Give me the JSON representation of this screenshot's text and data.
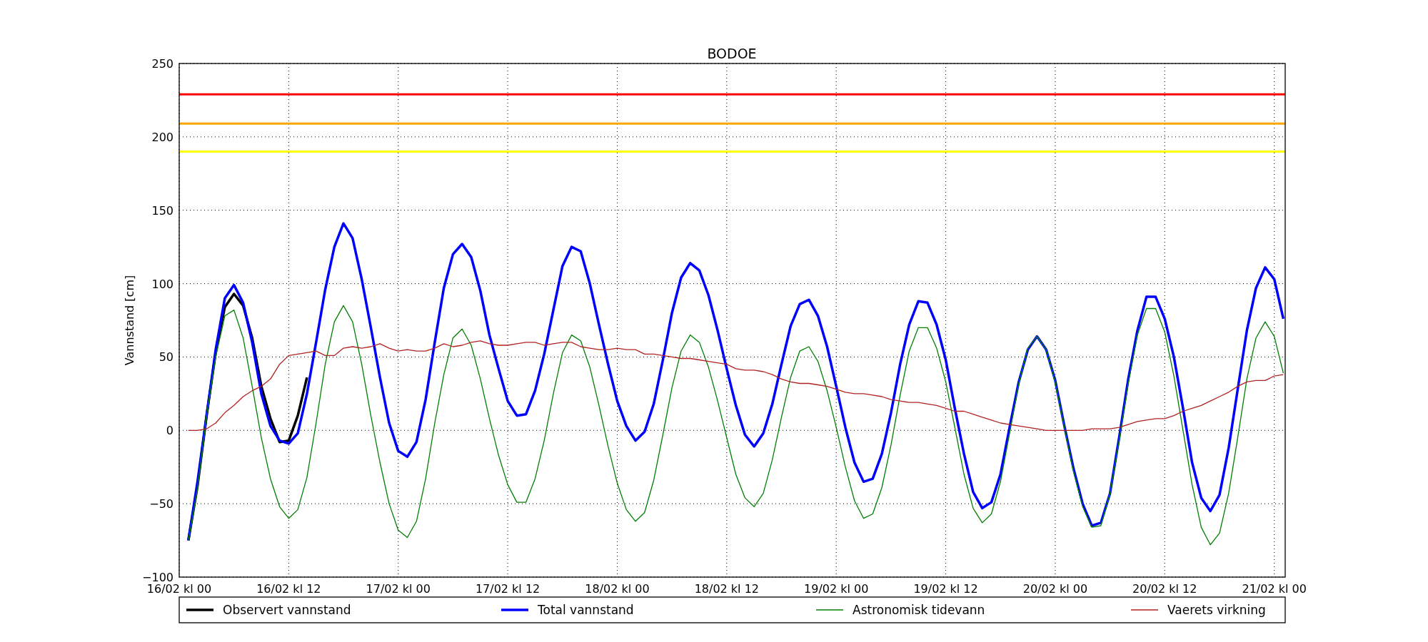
{
  "chart_data": {
    "type": "line",
    "title": "BODOE",
    "ylabel": "Vannstand [cm]",
    "categories": [
      "16/02 kl 00",
      null,
      null,
      null,
      null,
      null,
      null,
      null,
      null,
      null,
      null,
      null,
      "16/02 kl 12",
      null,
      null,
      null,
      null,
      null,
      null,
      null,
      null,
      null,
      null,
      null,
      "17/02 kl 00",
      null,
      null,
      null,
      null,
      null,
      null,
      null,
      null,
      null,
      null,
      null,
      "17/02 kl 12",
      null,
      null,
      null,
      null,
      null,
      null,
      null,
      null,
      null,
      null,
      null,
      "18/02 kl 00",
      null,
      null,
      null,
      null,
      null,
      null,
      null,
      null,
      null,
      null,
      null,
      "18/02 kl 12",
      null,
      null,
      null,
      null,
      null,
      null,
      null,
      null,
      null,
      null,
      null,
      "19/02 kl 00",
      null,
      null,
      null,
      null,
      null,
      null,
      null,
      null,
      null,
      null,
      null,
      "19/02 kl 12",
      null,
      null,
      null,
      null,
      null,
      null,
      null,
      null,
      null,
      null,
      null,
      "20/02 kl 00",
      null,
      null,
      null,
      null,
      null,
      null,
      null,
      null,
      null,
      null,
      null,
      "20/02 kl 12",
      null,
      null,
      null,
      null,
      null,
      null,
      null,
      null,
      null,
      null,
      null,
      "21/02 kl 00",
      null
    ],
    "ylim": [
      -100,
      250
    ],
    "yticks": [
      {
        "value": -100,
        "label": "−100"
      },
      {
        "value": -50,
        "label": "−50"
      },
      0,
      50,
      100,
      150,
      200,
      250
    ],
    "series": [
      {
        "name": "Observert vannstand",
        "color": "#000000",
        "values": [
          null,
          -75,
          -38,
          10,
          53,
          84,
          93,
          85,
          63,
          30,
          8,
          -8,
          -7,
          10,
          36,
          null,
          null,
          null,
          null,
          null,
          null,
          null,
          null,
          null,
          null,
          null,
          null,
          null,
          null,
          null,
          null,
          null,
          null,
          null,
          null,
          null,
          null,
          null,
          null,
          null,
          null,
          null,
          null,
          null,
          null,
          null,
          null,
          null,
          null,
          null,
          null,
          null,
          null,
          null,
          null,
          null,
          null,
          null,
          null,
          null,
          null,
          null,
          null,
          null,
          null,
          null,
          null,
          null,
          null,
          null,
          null,
          null,
          null,
          null,
          null,
          null,
          null,
          null,
          null,
          null,
          null,
          null,
          null,
          null,
          null,
          null,
          null,
          null,
          null,
          null,
          null,
          null,
          null,
          null,
          null,
          null,
          null,
          null,
          null,
          null,
          null,
          null,
          null,
          null,
          null,
          null,
          null,
          null,
          null,
          null,
          null,
          null,
          null,
          null,
          null,
          null,
          null,
          null,
          null,
          null,
          null,
          null
        ]
      },
      {
        "name": "Total vannstand",
        "color": "#0000ff",
        "values": [
          null,
          -75,
          -35,
          10,
          55,
          90,
          99,
          87,
          60,
          25,
          3,
          -7,
          -9,
          -2,
          25,
          60,
          96,
          125,
          141,
          131,
          103,
          70,
          36,
          5,
          -14,
          -18,
          -8,
          21,
          60,
          97,
          120,
          127,
          118,
          95,
          65,
          42,
          20,
          10,
          11,
          27,
          52,
          82,
          112,
          125,
          122,
          100,
          72,
          45,
          20,
          3,
          -7,
          -1,
          18,
          48,
          80,
          104,
          114,
          109,
          92,
          68,
          42,
          17,
          -3,
          -11,
          -2,
          18,
          45,
          71,
          86,
          89,
          78,
          57,
          30,
          2,
          -22,
          -35,
          -33,
          -16,
          12,
          45,
          72,
          88,
          87,
          72,
          48,
          15,
          -16,
          -42,
          -53,
          -49,
          -30,
          2,
          33,
          55,
          64,
          55,
          34,
          3,
          -26,
          -50,
          -65,
          -63,
          -43,
          -5,
          35,
          68,
          91,
          91,
          76,
          50,
          15,
          -22,
          -46,
          -55,
          -44,
          -12,
          28,
          68,
          97,
          111,
          103,
          76
        ]
      },
      {
        "name": "Astronomisk tidevann",
        "color": "#008000",
        "values": [
          null,
          -75,
          -40,
          10,
          50,
          78,
          82,
          63,
          30,
          -5,
          -33,
          -52,
          -60,
          -54,
          -32,
          5,
          45,
          74,
          85,
          74,
          45,
          10,
          -22,
          -50,
          -68,
          -73,
          -62,
          -33,
          5,
          38,
          63,
          69,
          58,
          35,
          8,
          -17,
          -37,
          -49,
          -49,
          -33,
          -7,
          25,
          53,
          65,
          61,
          43,
          17,
          -11,
          -36,
          -54,
          -62,
          -56,
          -34,
          -3,
          29,
          54,
          65,
          60,
          43,
          20,
          -5,
          -30,
          -46,
          -52,
          -43,
          -20,
          9,
          36,
          54,
          57,
          47,
          27,
          2,
          -25,
          -48,
          -60,
          -57,
          -39,
          -10,
          24,
          54,
          70,
          70,
          56,
          33,
          2,
          -30,
          -53,
          -63,
          -57,
          -35,
          -2,
          32,
          56,
          64,
          55,
          33,
          2,
          -28,
          -52,
          -66,
          -65,
          -43,
          -7,
          32,
          65,
          83,
          83,
          67,
          37,
          0,
          -37,
          -66,
          -78,
          -70,
          -43,
          -5,
          35,
          63,
          74,
          64,
          39
        ]
      },
      {
        "name": "Vaerets virkning",
        "color": "#b22222",
        "values": [
          null,
          0,
          0,
          1,
          5,
          12,
          17,
          23,
          27,
          30,
          35,
          45,
          51,
          52,
          53,
          54,
          51,
          51,
          56,
          57,
          56,
          57,
          59,
          56,
          54,
          55,
          54,
          54,
          56,
          59,
          57,
          58,
          60,
          61,
          59,
          58,
          58,
          59,
          60,
          60,
          58,
          59,
          60,
          60,
          57,
          56,
          55,
          55,
          56,
          55,
          55,
          52,
          52,
          51,
          50,
          49,
          49,
          48,
          47,
          46,
          45,
          42,
          41,
          41,
          40,
          38,
          35,
          33,
          32,
          32,
          31,
          30,
          28,
          26,
          25,
          25,
          24,
          23,
          21,
          20,
          19,
          19,
          18,
          17,
          15,
          13,
          13,
          11,
          9,
          7,
          5,
          4,
          3,
          2,
          1,
          0,
          0,
          0,
          0,
          0,
          1,
          1,
          1,
          2,
          4,
          6,
          7,
          8,
          8,
          10,
          13,
          15,
          17,
          20,
          23,
          26,
          30,
          33,
          34,
          34,
          37,
          38
        ]
      }
    ],
    "ref_lines": [
      {
        "axis": "y",
        "value": 229,
        "color": "#ff0000"
      },
      {
        "axis": "y",
        "value": 209,
        "color": "#ffa500"
      },
      {
        "axis": "y",
        "value": 190,
        "color": "#ffff00"
      }
    ],
    "grid": true,
    "legend": true
  }
}
